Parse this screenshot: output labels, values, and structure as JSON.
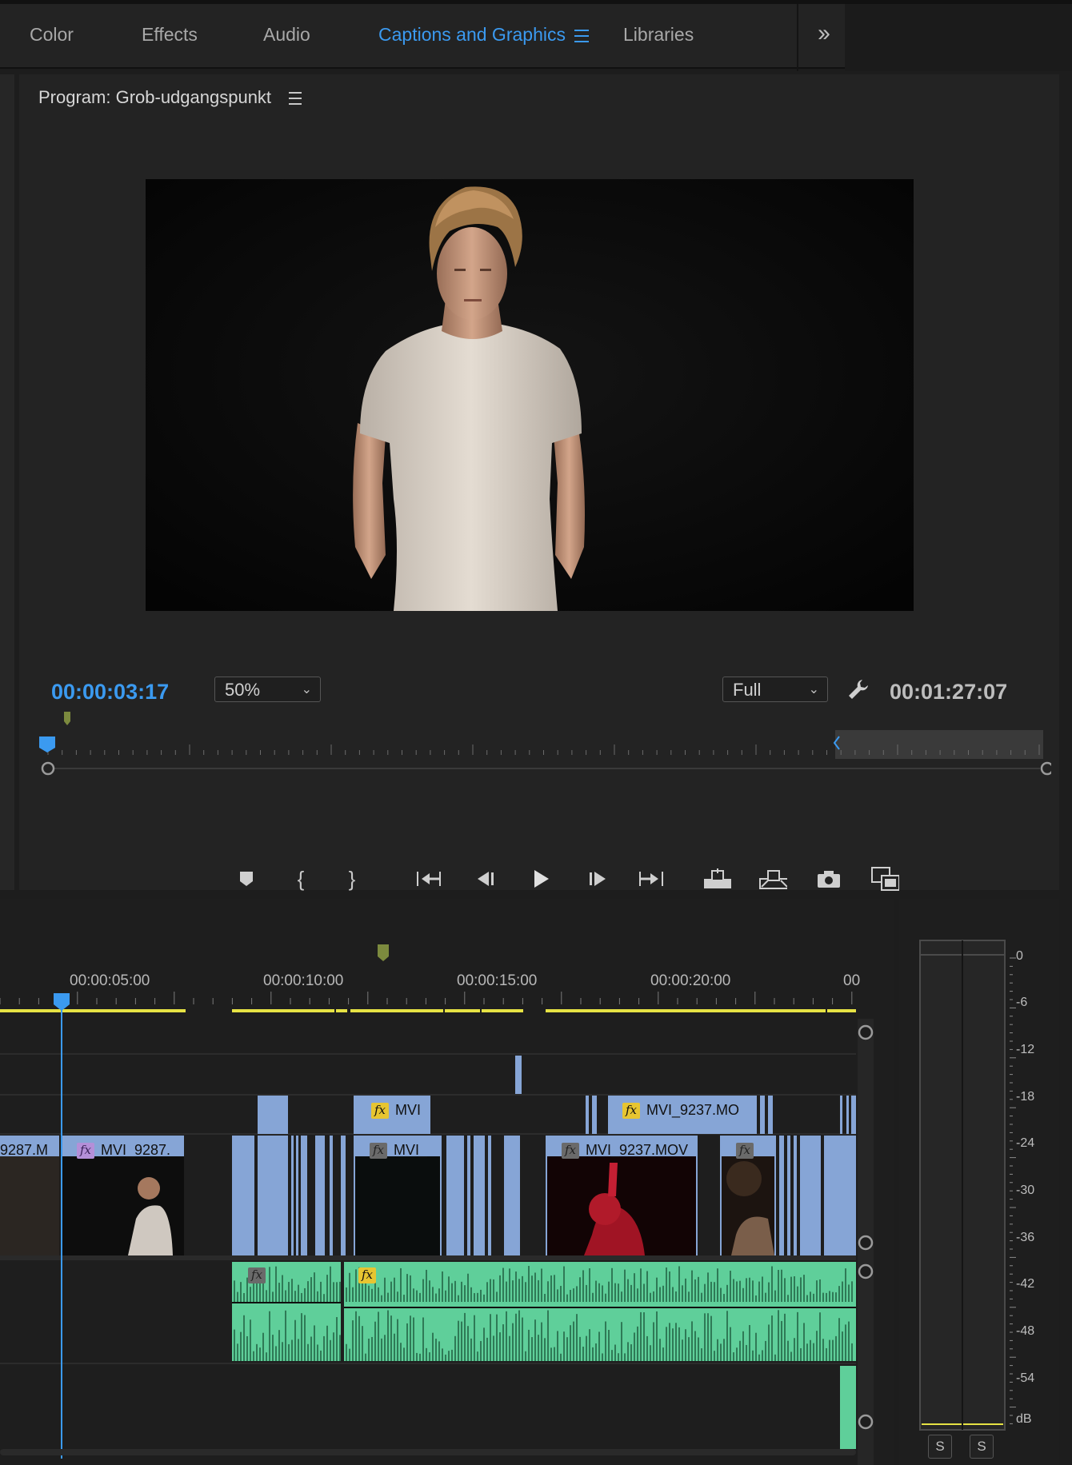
{
  "workspaces": {
    "tabs": [
      {
        "label": "Color"
      },
      {
        "label": "Effects"
      },
      {
        "label": "Audio"
      },
      {
        "label": "Captions and Graphics"
      },
      {
        "label": "Libraries"
      }
    ],
    "active": "Captions and Graphics",
    "overflow_icon": "double-chevron-right-icon"
  },
  "program_monitor": {
    "title": "Program: Grob-udgangspunkt",
    "current_timecode": "00:00:03:17",
    "zoom": "50%",
    "resolution": "Full",
    "duration_timecode": "00:01:27:07",
    "accent_color": "#3b9af0",
    "transport": [
      "add-marker-icon",
      "mark-in-icon",
      "mark-out-icon",
      "go-to-in-icon",
      "step-back-icon",
      "play-icon",
      "step-forward-icon",
      "go-to-out-icon",
      "lift-icon",
      "extract-icon",
      "export-frame-icon",
      "comparison-view-icon"
    ],
    "loop_icon": "loop-icon",
    "add_button_icon": "plus-icon"
  },
  "timeline": {
    "ruler_labels": [
      "00:00:05:00",
      "00:00:10:00",
      "00:00:15:00",
      "00:00:20:00",
      "00"
    ],
    "clips": {
      "v3_left": "MVI",
      "v3_right": "MVI_9237.MO",
      "v1_a": "9287.M",
      "v1_b": "MVI_9287.",
      "v1_c": "MVI_",
      "v1_d": "MVI_9237.MOV"
    },
    "audio_clip_color": "#5fcf9a",
    "video_clip_color": "#86a5d6"
  },
  "audio_meter": {
    "scale": [
      "0",
      "-6",
      "-12",
      "-18",
      "-24",
      "-30",
      "-36",
      "-42",
      "-48",
      "-54",
      "dB"
    ],
    "solo_labels": [
      "S",
      "S"
    ]
  }
}
